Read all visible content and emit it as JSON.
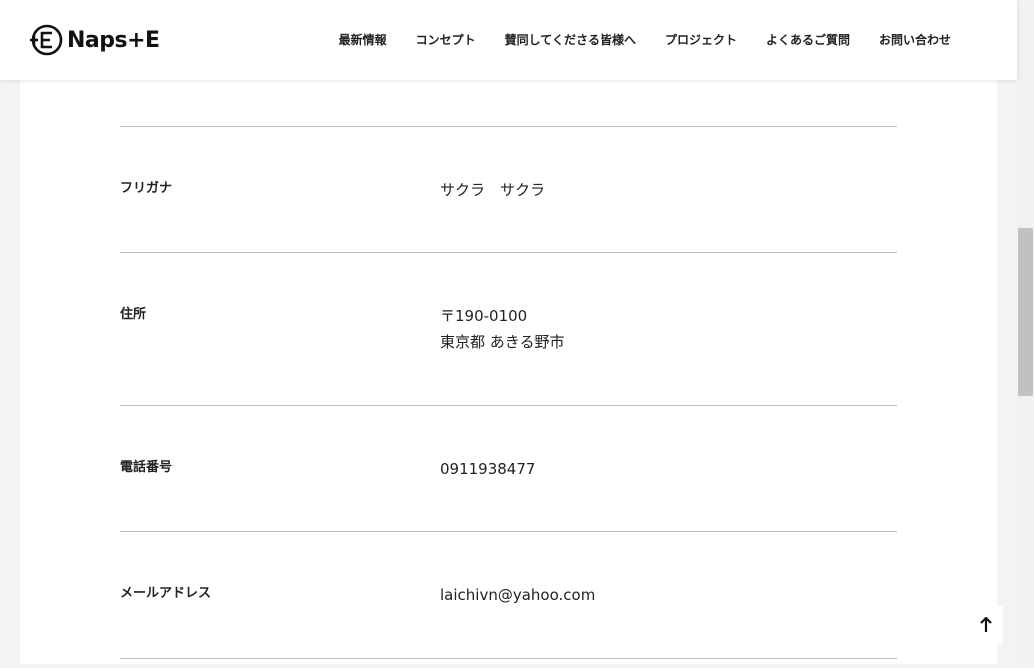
{
  "brand": {
    "logo_text": "Naps+E"
  },
  "nav": {
    "items": [
      {
        "label": "最新情報"
      },
      {
        "label": "コンセプト"
      },
      {
        "label": "賛同してくださる皆様へ"
      },
      {
        "label": "プロジェクト"
      },
      {
        "label": "よくあるご質問"
      },
      {
        "label": "お問い合わせ"
      }
    ]
  },
  "form_confirm": {
    "rows": [
      {
        "label": "フリガナ",
        "value": "サクラ　サクラ"
      },
      {
        "label": "住所",
        "value_line1": "〒190-0100",
        "value_line2": "東京都 あきる野市"
      },
      {
        "label": "電話番号",
        "value": "0911938477"
      },
      {
        "label": "メールアドレス",
        "value": "laichivn@yahoo.com"
      }
    ]
  },
  "icons": {
    "logo": "plus-e-circle-logo-icon",
    "back_to_top": "arrow-up-icon"
  }
}
